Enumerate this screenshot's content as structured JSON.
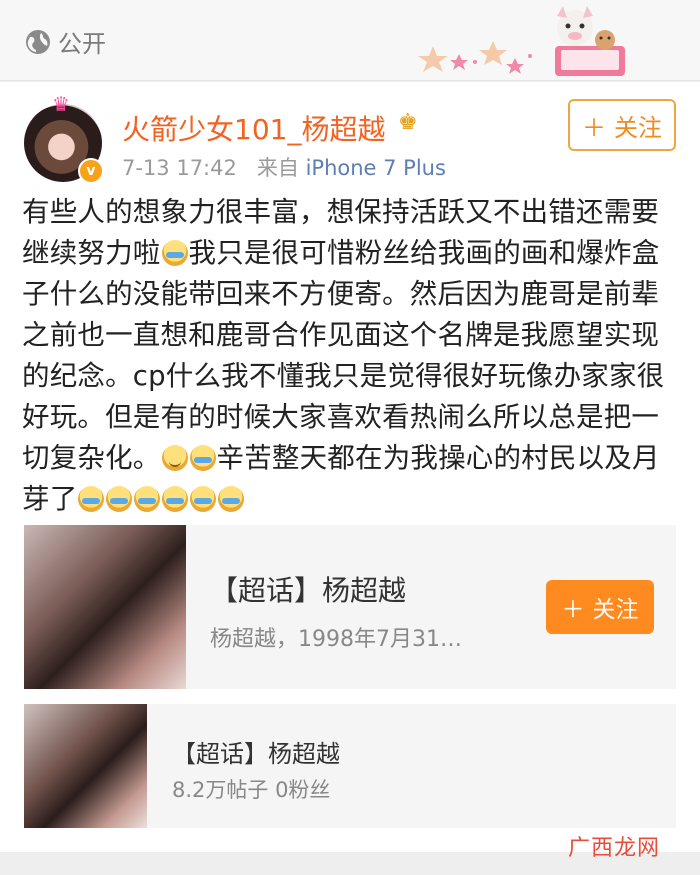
{
  "header": {
    "visibility_label": "公开",
    "globe_icon": "globe-icon"
  },
  "post": {
    "username": "火箭少女101_杨超越",
    "timestamp": "7-13 17:42",
    "source_prefix": "来自",
    "source": "iPhone 7 Plus",
    "follow_label": "关注",
    "text_parts": [
      "有些人的想象力很丰富，想保持活跃又不出错还需要继续努力啦",
      "我只是很可惜粉丝给我画的画和爆炸盒子什么的没能带回来不方便寄。然后因为鹿哥是前辈之前也一直想和鹿哥合作见面这个名牌是我愿望实现的纪念。cp什么我不懂我只是觉得很好玩像办家家很好玩。但是有的时候大家喜欢看热闹么所以总是把一切复杂化。",
      "辛苦整天都在为我操心的村民以及月芽了"
    ]
  },
  "super_topic_card": {
    "title": "【超话】杨超越",
    "subtitle": "杨超越，1998年7月31…",
    "follow_label": "关注"
  },
  "super_topic_card_2": {
    "title": "【超话】杨超越",
    "subtitle": "8.2万帖子 0粉丝"
  },
  "watermark": "广西龙网",
  "colors": {
    "accent": "#f26322",
    "follow_orange": "#ff8a1f",
    "link_blue": "#5d7eb5"
  }
}
